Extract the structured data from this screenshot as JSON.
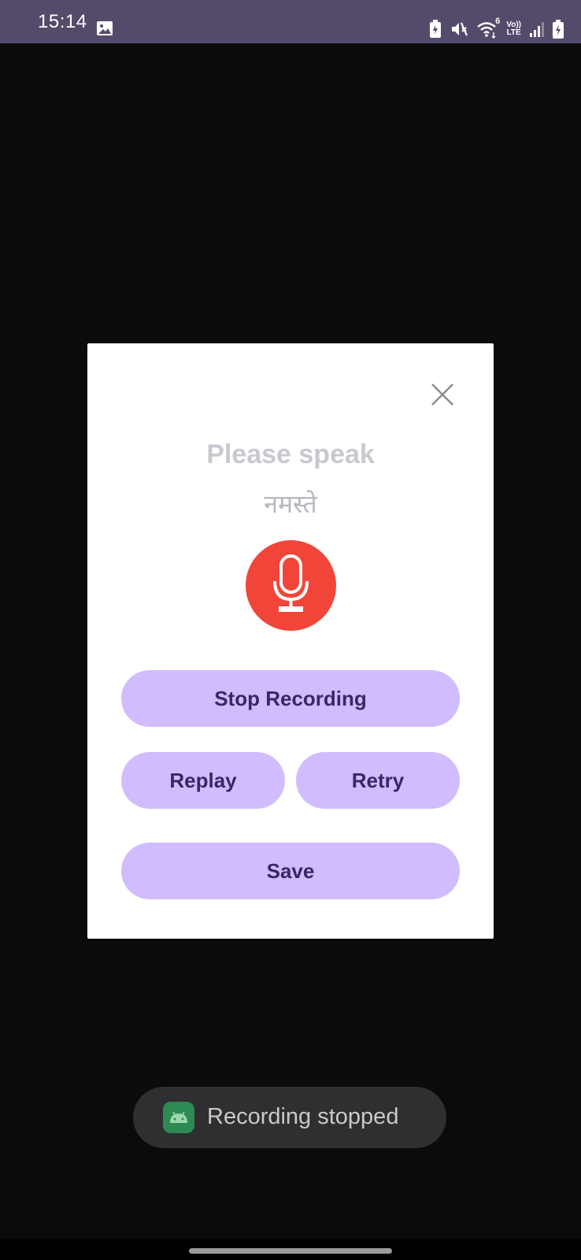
{
  "status_bar": {
    "time": "15:14",
    "icons": [
      "gallery-icon",
      "battery-saver-icon",
      "mute-icon",
      "wifi-icon",
      "volte-icon",
      "signal-icon",
      "battery-charging-icon"
    ],
    "wifi_label": "6",
    "volte_top": "Vo))",
    "volte_bottom": "LTE"
  },
  "dialog": {
    "title": "Please speak",
    "word": "नमस्ते",
    "mic_color": "#f2453a",
    "buttons": {
      "stop": "Stop Recording",
      "replay": "Replay",
      "retry": "Retry",
      "save": "Save"
    },
    "button_color": "#d0bcfe",
    "button_text_color": "#3a2766"
  },
  "toast": {
    "text": "Recording stopped",
    "icon": "android-app-icon"
  },
  "colors": {
    "status_bar": "#544b6b",
    "background": "#0b0b0c"
  }
}
